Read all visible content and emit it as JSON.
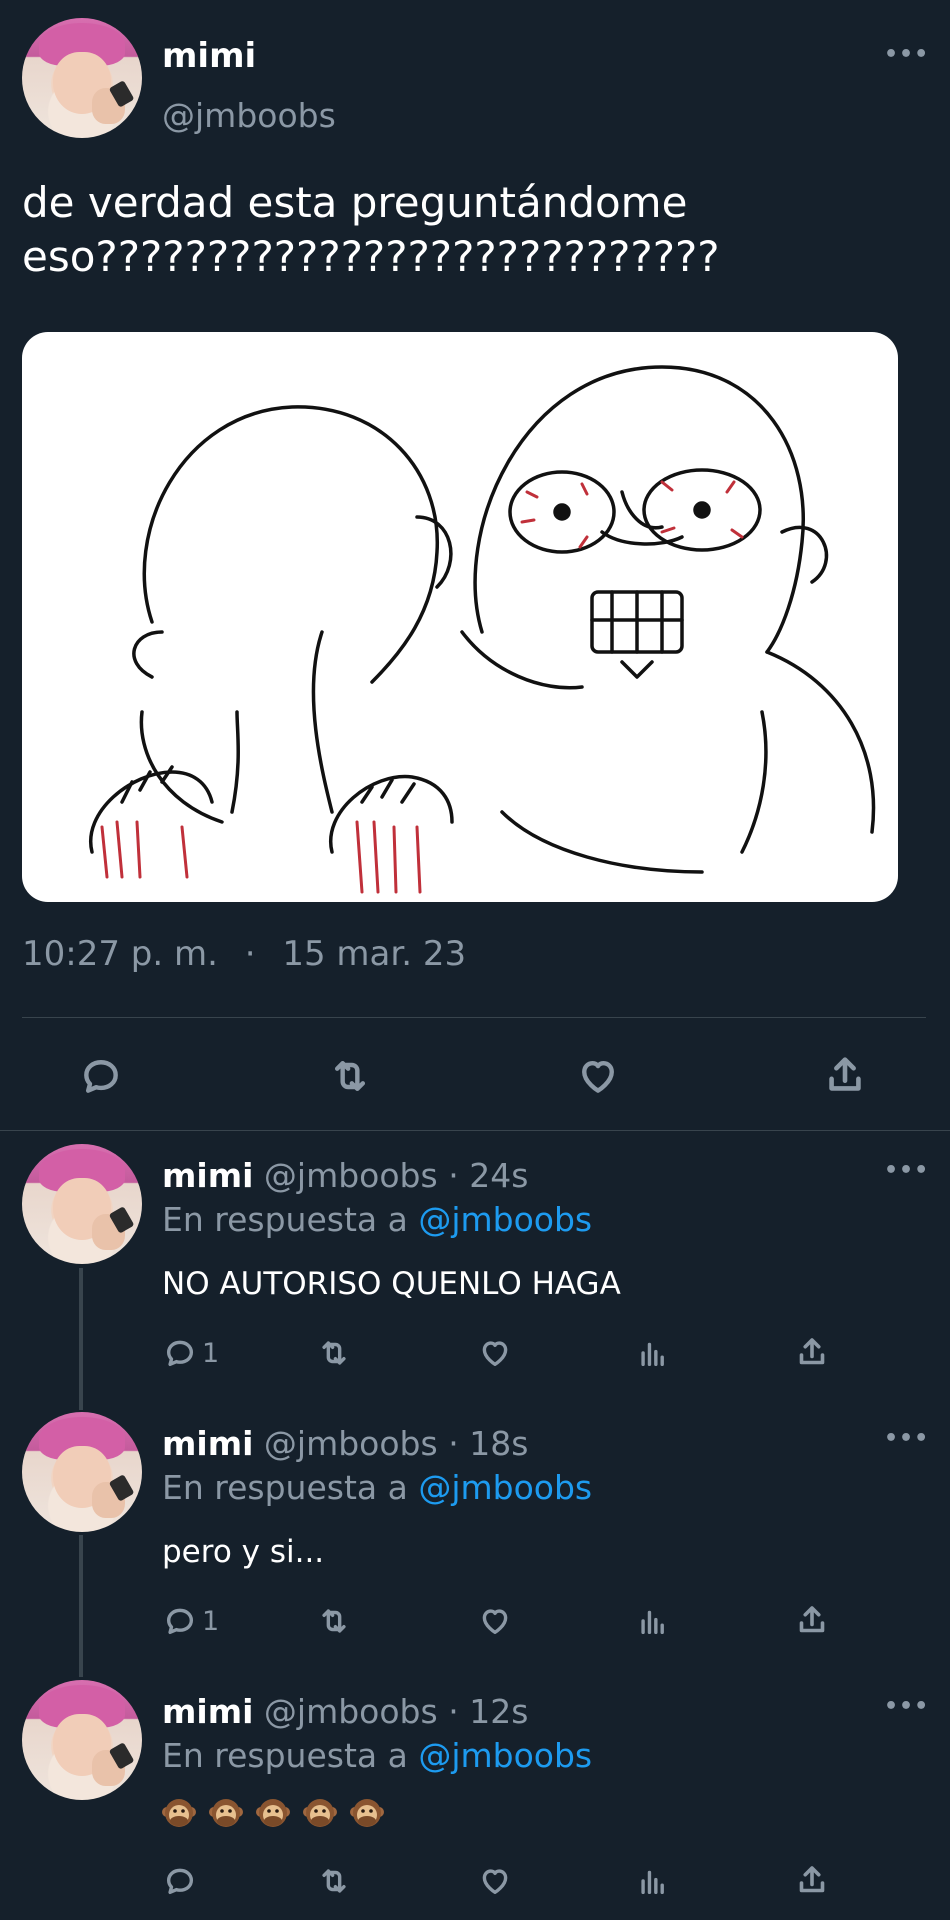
{
  "main_tweet": {
    "display_name": "mimi",
    "handle": "@jmboobs",
    "text_line1": "de verdad esta preguntándome",
    "text_line2": "eso????????????????????????????",
    "time": "10:27 p. m.",
    "separator": "·",
    "date": "15 mar. 23",
    "actions": [
      "reply-icon",
      "retweet-icon",
      "like-icon",
      "share-icon"
    ]
  },
  "replies": [
    {
      "display_name": "mimi",
      "handle": "@jmboobs",
      "dot": "·",
      "age": "24s",
      "reply_prefix": "En respuesta a",
      "reply_to": "@jmboobs",
      "text": "NO AUTORISO QUENLO HAGA",
      "reply_count": "1"
    },
    {
      "display_name": "mimi",
      "handle": "@jmboobs",
      "dot": "·",
      "age": "18s",
      "reply_prefix": "En respuesta a",
      "reply_to": "@jmboobs",
      "text": "pero y si...",
      "reply_count": "1"
    },
    {
      "display_name": "mimi",
      "handle": "@jmboobs",
      "dot": "·",
      "age": "12s",
      "reply_prefix": "En respuesta a",
      "reply_to": "@jmboobs",
      "emoji_count": 5,
      "emoji": "speak-no-evil-monkey-icon",
      "reply_count": ""
    }
  ],
  "more_label": "•••",
  "colors": {
    "background": "#15202b",
    "muted": "#8b98a5",
    "link": "#1d9bf0",
    "divider": "#38444d"
  }
}
